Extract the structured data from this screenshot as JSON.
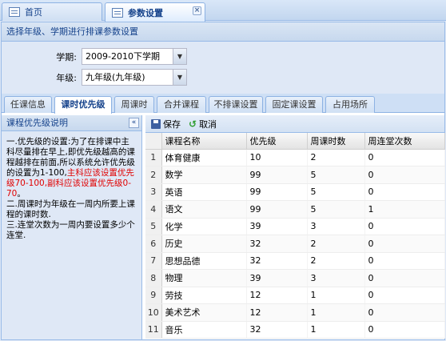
{
  "top_tabs": [
    {
      "label": "首页",
      "icon": "page-icon"
    },
    {
      "label": "参数设置",
      "icon": "page-icon",
      "closable": true
    }
  ],
  "panel": {
    "title": "选择年级、学期进行排课参数设置"
  },
  "form": {
    "semester_label": "学期:",
    "semester_value": "2009-2010下学期",
    "grade_label": "年级:",
    "grade_value": "九年级(九年级)"
  },
  "sub_tabs": [
    "任课信息",
    "课时优先级",
    "周课时",
    "合并课程",
    "不排课设置",
    "固定课设置",
    "占用场所"
  ],
  "left_panel": {
    "title": "课程优先级说明",
    "text1": "一.优先级的设置:为了在排课中主科尽量排在早上,即优先级越高的课程越排在前面,所以系统允许优先级的设置为1-100,",
    "text_red": "主科应该设置优先级70-100,副科应该设置优先级0-70",
    "text2": "。",
    "text3": "二.周课时为年级在一周内所要上课程的课时数.",
    "text4": "三.连堂次数为一周内要设置多少个连堂."
  },
  "toolbar": {
    "save_label": "保存",
    "cancel_label": "取消"
  },
  "grid": {
    "headers": [
      "课程名称",
      "优先级",
      "周课时数",
      "周连堂次数"
    ],
    "rows": [
      {
        "n": "1",
        "name": "体育健康",
        "priority": "10",
        "weekly": "2",
        "consecutive": "0"
      },
      {
        "n": "2",
        "name": "数学",
        "priority": "99",
        "weekly": "5",
        "consecutive": "0"
      },
      {
        "n": "3",
        "name": "英语",
        "priority": "99",
        "weekly": "5",
        "consecutive": "0"
      },
      {
        "n": "4",
        "name": "语文",
        "priority": "99",
        "weekly": "5",
        "consecutive": "1"
      },
      {
        "n": "5",
        "name": "化学",
        "priority": "39",
        "weekly": "3",
        "consecutive": "0"
      },
      {
        "n": "6",
        "name": "历史",
        "priority": "32",
        "weekly": "2",
        "consecutive": "0"
      },
      {
        "n": "7",
        "name": "思想品德",
        "priority": "32",
        "weekly": "2",
        "consecutive": "0"
      },
      {
        "n": "8",
        "name": "物理",
        "priority": "39",
        "weekly": "3",
        "consecutive": "0"
      },
      {
        "n": "9",
        "name": "劳技",
        "priority": "12",
        "weekly": "1",
        "consecutive": "0"
      },
      {
        "n": "10",
        "name": "美术艺术",
        "priority": "12",
        "weekly": "1",
        "consecutive": "0"
      },
      {
        "n": "11",
        "name": "音乐",
        "priority": "32",
        "weekly": "1",
        "consecutive": "0"
      }
    ]
  }
}
